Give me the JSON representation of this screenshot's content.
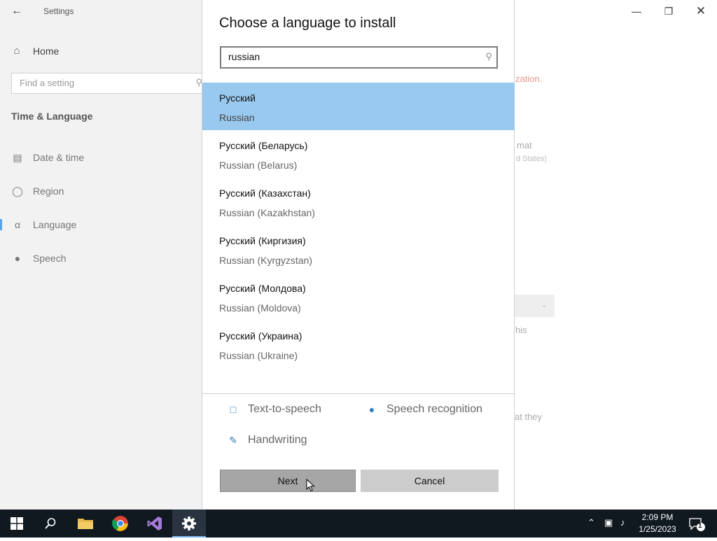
{
  "settings": {
    "title": "Settings",
    "home_label": "Home",
    "search_placeholder": "Find a setting",
    "section_title": "Time & Language",
    "nav_items": [
      {
        "label": "Date & time",
        "icon": "date-time-icon"
      },
      {
        "label": "Region",
        "icon": "globe-icon"
      },
      {
        "label": "Language",
        "icon": "language-icon",
        "selected": true
      },
      {
        "label": "Speech",
        "icon": "microphone-icon"
      }
    ],
    "main_fragments": [
      "zation.",
      "mat",
      "d States)",
      "his",
      "at they"
    ]
  },
  "dialog": {
    "title": "Choose a language to install",
    "search_value": "russian",
    "languages": [
      {
        "native": "Русский",
        "english": "Russian",
        "selected": true
      },
      {
        "native": "Русский (Беларусь)",
        "english": "Russian (Belarus)"
      },
      {
        "native": "Русский (Казахстан)",
        "english": "Russian (Kazakhstan)"
      },
      {
        "native": "Русский (Киргизия)",
        "english": "Russian (Kyrgyzstan)"
      },
      {
        "native": "Русский (Молдова)",
        "english": "Russian (Moldova)"
      },
      {
        "native": "Русский (Украина)",
        "english": "Russian (Ukraine)"
      }
    ],
    "features": [
      "Text-to-speech",
      "Speech recognition",
      "Handwriting"
    ],
    "next_label": "Next",
    "cancel_label": "Cancel"
  },
  "taskbar": {
    "time": "2:09 PM",
    "date": "1/25/2023",
    "notification_count": "1",
    "apps": [
      "windows-start",
      "search",
      "file-explorer",
      "chrome",
      "visual-studio",
      "settings"
    ]
  },
  "colors": {
    "selection": "#99c9ee",
    "accent": "#2f7cc2",
    "taskbar": "#101820",
    "sidebar": "#f2f2f2"
  }
}
